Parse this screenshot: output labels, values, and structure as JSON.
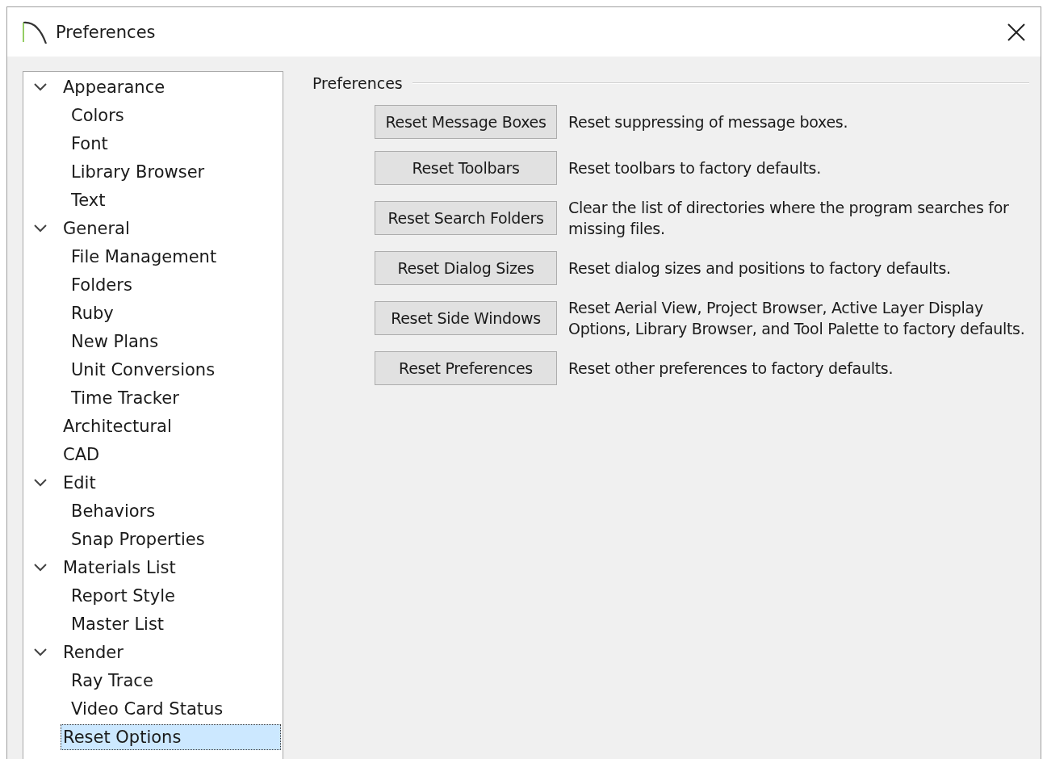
{
  "window": {
    "title": "Preferences"
  },
  "tree": [
    {
      "label": "Appearance",
      "expanded": true,
      "selected": false,
      "children": [
        {
          "label": "Colors",
          "selected": false
        },
        {
          "label": "Font",
          "selected": false
        },
        {
          "label": "Library Browser",
          "selected": false
        },
        {
          "label": "Text",
          "selected": false
        }
      ]
    },
    {
      "label": "General",
      "expanded": true,
      "selected": false,
      "children": [
        {
          "label": "File Management",
          "selected": false
        },
        {
          "label": "Folders",
          "selected": false
        },
        {
          "label": "Ruby",
          "selected": false
        },
        {
          "label": "New Plans",
          "selected": false
        },
        {
          "label": "Unit Conversions",
          "selected": false
        },
        {
          "label": "Time Tracker",
          "selected": false
        }
      ]
    },
    {
      "label": "Architectural",
      "selected": false
    },
    {
      "label": "CAD",
      "selected": false
    },
    {
      "label": "Edit",
      "expanded": true,
      "selected": false,
      "children": [
        {
          "label": "Behaviors",
          "selected": false
        },
        {
          "label": "Snap Properties",
          "selected": false
        }
      ]
    },
    {
      "label": "Materials List",
      "expanded": true,
      "selected": false,
      "children": [
        {
          "label": "Report Style",
          "selected": false
        },
        {
          "label": "Master List",
          "selected": false
        }
      ]
    },
    {
      "label": "Render",
      "expanded": true,
      "selected": false,
      "children": [
        {
          "label": "Ray Trace",
          "selected": false
        },
        {
          "label": "Video Card Status",
          "selected": false
        }
      ]
    },
    {
      "label": "Reset Options",
      "selected": true
    }
  ],
  "group": {
    "title": "Preferences",
    "rows": [
      {
        "button": "Reset Message Boxes",
        "description": "Reset suppressing of message boxes."
      },
      {
        "button": "Reset Toolbars",
        "description": "Reset toolbars to factory defaults."
      },
      {
        "button": "Reset Search Folders",
        "description": "Clear the list of directories where the program searches for missing files."
      },
      {
        "button": "Reset Dialog Sizes",
        "description": "Reset dialog sizes and positions to factory defaults."
      },
      {
        "button": "Reset Side Windows",
        "description": "Reset Aerial View, Project Browser, Active Layer Display Options, Library Browser, and Tool Palette to factory defaults."
      },
      {
        "button": "Reset Preferences",
        "description": "Reset other preferences to factory defaults."
      }
    ]
  }
}
